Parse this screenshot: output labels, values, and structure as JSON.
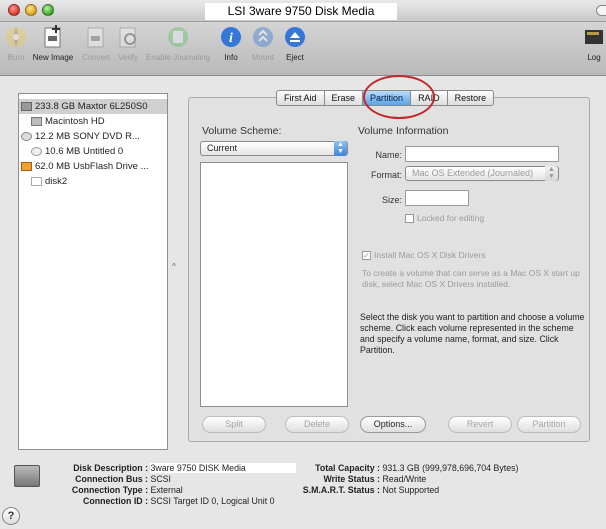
{
  "window": {
    "title": "LSI 3ware 9750 Disk Media"
  },
  "toolbar": {
    "items": [
      {
        "label": "Burn",
        "icon": "burn-icon",
        "enabled": false
      },
      {
        "label": "New Image",
        "icon": "new-image-icon",
        "enabled": true
      },
      {
        "label": "Convert",
        "icon": "convert-icon",
        "enabled": false
      },
      {
        "label": "Verify",
        "icon": "verify-icon",
        "enabled": false
      },
      {
        "label": "Enable Journaling",
        "icon": "enable-journaling-icon",
        "enabled": false
      },
      {
        "label": "Info",
        "icon": "info-icon",
        "enabled": true
      },
      {
        "label": "Mount",
        "icon": "mount-icon",
        "enabled": false
      },
      {
        "label": "Eject",
        "icon": "eject-icon",
        "enabled": true
      },
      {
        "label": "Log",
        "icon": "log-icon",
        "enabled": true
      }
    ]
  },
  "sidebar": {
    "items": [
      {
        "label": "233.8 GB Maxtor 6L250S0",
        "icon": "hard-disk-icon",
        "level": 0
      },
      {
        "label": "Macintosh HD",
        "icon": "volume-icon",
        "level": 1
      },
      {
        "label": "12.2 MB SONY   DVD R...",
        "icon": "optical-drive-icon",
        "level": 0
      },
      {
        "label": "10.6 MB Untitled 0",
        "icon": "disc-icon",
        "level": 1
      },
      {
        "label": "62.0 MB UsbFlash Drive ...",
        "icon": "usb-drive-icon",
        "level": 0
      },
      {
        "label": "disk2",
        "icon": "volume-icon",
        "level": 1
      }
    ]
  },
  "tabs": [
    {
      "label": "First Aid",
      "active": false
    },
    {
      "label": "Erase",
      "active": false
    },
    {
      "label": "Partition",
      "active": true
    },
    {
      "label": "RAID",
      "active": false
    },
    {
      "label": "Restore",
      "active": false
    }
  ],
  "partition": {
    "volume_scheme_label": "Volume Scheme:",
    "volume_scheme_value": "Current",
    "volume_info_label": "Volume Information",
    "name_label": "Name:",
    "name_value": "",
    "format_label": "Format:",
    "format_value": "Mac OS Extended (Journaled)",
    "size_label": "Size:",
    "size_value": "",
    "locked_label": "Locked for editing",
    "install_drivers_label": "Install Mac OS X Disk Drivers",
    "install_drivers_checked": true,
    "drivers_note": "To create a volume that can serve as a Mac OS X start up disk, select Mac OS X Drivers installed.",
    "instructions": "Select the disk you want to partition and choose a volume scheme. Click each volume represented in the scheme and specify a volume name, format, and size. Click Partition.",
    "buttons": {
      "split": "Split",
      "delete": "Delete",
      "options": "Options...",
      "revert": "Revert",
      "partition": "Partition"
    }
  },
  "disk_info": {
    "description_key": "Disk Description :",
    "description_value": "3ware 9750 DISK Media",
    "bus_key": "Connection Bus :",
    "bus_value": "SCSI",
    "type_key": "Connection Type :",
    "type_value": "External",
    "id_key": "Connection ID :",
    "id_value": "SCSI Target ID 0, Logical Unit 0",
    "capacity_key": "Total Capacity :",
    "capacity_value": "931.3 GB (999,978,696,704 Bytes)",
    "write_key": "Write Status :",
    "write_value": "Read/Write",
    "smart_key": "S.M.A.R.T. Status :",
    "smart_value": "Not Supported"
  },
  "help": {
    "label": "?"
  },
  "colors": {
    "accent": "#5ba3e6",
    "highlight_circle": "#c0282a"
  }
}
